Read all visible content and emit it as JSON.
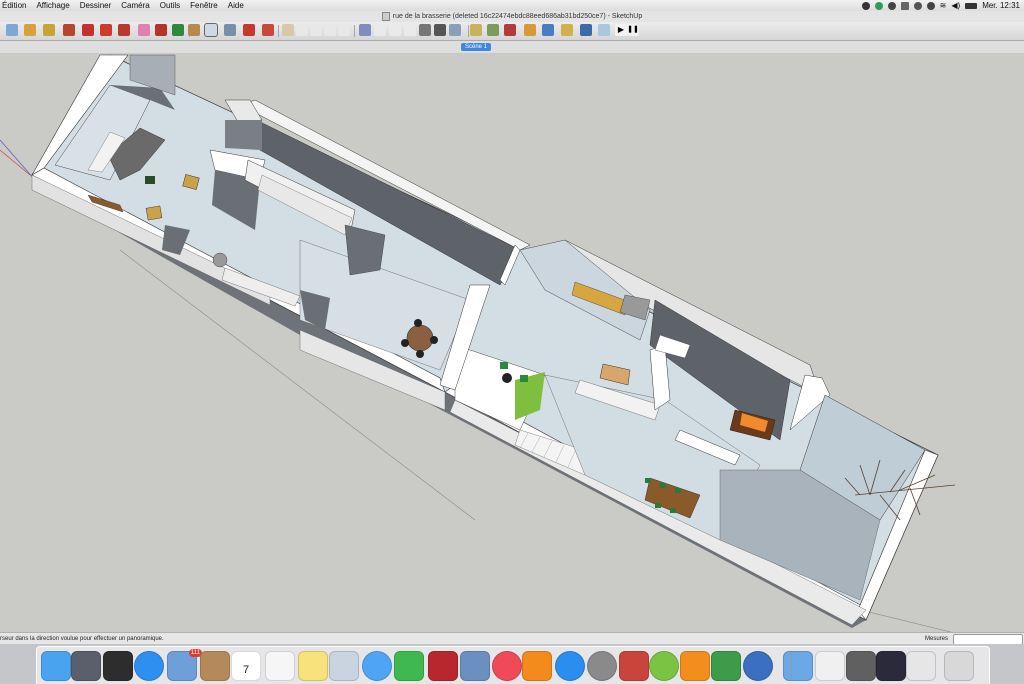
{
  "menubar": {
    "items": [
      "Édition",
      "Affichage",
      "Dessiner",
      "Caméra",
      "Outils",
      "Fenêtre",
      "Aide"
    ],
    "clock": "Mer. 12:31"
  },
  "window": {
    "title": "rue de la brasserie (deleted 16c22474ebdc88eed686ab31bd250ce7) - SketchUp"
  },
  "toolbar": {
    "icons": [
      "select-icon",
      "eraser-icon",
      "paint-bucket-icon",
      "line-icon",
      "rectangle-icon",
      "circle-icon",
      "arc-icon",
      "push-pull-icon",
      "move-icon",
      "rotate-icon",
      "offset-icon",
      "orbit-icon",
      "zoom-icon",
      "zoom-extents-icon",
      "walk-icon",
      "standard-views-icons",
      "style-icons",
      "extension-icons",
      "play-icon",
      "pause-icon"
    ]
  },
  "scenes": {
    "tabs": [
      "Scène 1"
    ]
  },
  "statusbar": {
    "text": "rseur dans la direction voulue pour effectuer un panoramique.",
    "measure_label": "Mesures",
    "measure_value": ""
  },
  "dock": {
    "apps": [
      {
        "name": "finder",
        "color": "#4aa3f0"
      },
      {
        "name": "launchpad",
        "color": "#5a5f6b"
      },
      {
        "name": "mission-control",
        "color": "#2d2d2d"
      },
      {
        "name": "safari",
        "color": "#2f8ff0"
      },
      {
        "name": "mail",
        "color": "#6f9fd8",
        "badge": "111"
      },
      {
        "name": "contacts",
        "color": "#b58a5a"
      },
      {
        "name": "calendar",
        "color": "#ffffff",
        "day": "7"
      },
      {
        "name": "reminders",
        "color": "#f6f6f6"
      },
      {
        "name": "notes",
        "color": "#f7e27b"
      },
      {
        "name": "preview",
        "color": "#c9d4e0"
      },
      {
        "name": "messages",
        "color": "#4fa5f5"
      },
      {
        "name": "facetime",
        "color": "#3fb84f"
      },
      {
        "name": "photo-booth",
        "color": "#b8262e"
      },
      {
        "name": "iphoto",
        "color": "#6b8fbf"
      },
      {
        "name": "itunes",
        "color": "#f04a5a"
      },
      {
        "name": "ibooks",
        "color": "#f28b1c"
      },
      {
        "name": "app-store",
        "color": "#2a8ef0"
      },
      {
        "name": "system-preferences",
        "color": "#8a8a8a"
      },
      {
        "name": "sketchup",
        "color": "#c9453c"
      },
      {
        "name": "spotify",
        "color": "#7bc342"
      },
      {
        "name": "vlc",
        "color": "#f28f1c"
      },
      {
        "name": "crossover",
        "color": "#3d9b4a"
      },
      {
        "name": "google-earth",
        "color": "#3b6fc1"
      },
      {
        "name": "applications-folder",
        "color": "#6aa8e8"
      },
      {
        "name": "document-stack",
        "color": "#f0f0f0"
      },
      {
        "name": "screenshot-stack",
        "color": "#606060"
      },
      {
        "name": "desktop-stack",
        "color": "#2a2a3a"
      },
      {
        "name": "downloads-stack",
        "color": "#e6e6e6"
      },
      {
        "name": "trash",
        "color": "#d8d8d8"
      }
    ]
  }
}
